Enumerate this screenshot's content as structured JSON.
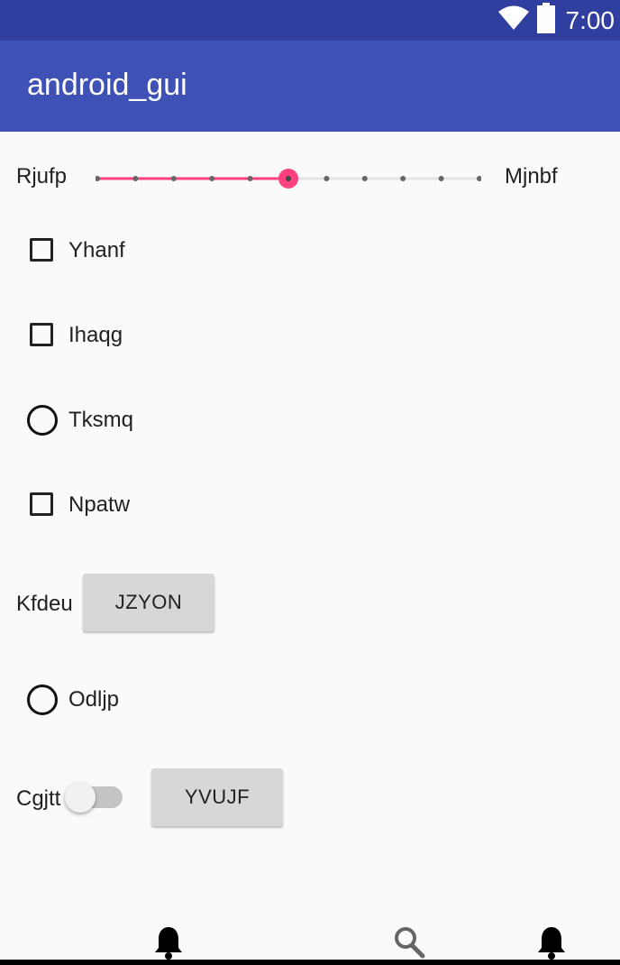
{
  "status_bar": {
    "time": "7:00",
    "icons": [
      "wifi-icon",
      "battery-icon"
    ]
  },
  "app_bar": {
    "title": "android_gui"
  },
  "slider": {
    "left_label": "Rjufp",
    "right_label": "Mjnbf",
    "steps": 10,
    "value": 5,
    "accent_color": "#ff4081"
  },
  "options": [
    {
      "type": "checkbox",
      "label": "Yhanf",
      "checked": false
    },
    {
      "type": "checkbox",
      "label": "Ihaqg",
      "checked": false
    },
    {
      "type": "radio",
      "label": "Tksmq",
      "checked": false
    },
    {
      "type": "checkbox",
      "label": "Npatw",
      "checked": false
    }
  ],
  "button_row": {
    "label": "Kfdeu",
    "button": "JZYON"
  },
  "radio_odljp": {
    "label": "Odljp",
    "checked": false
  },
  "switch_row": {
    "label": "Cgjtt",
    "on": false,
    "button": "YVUJF"
  },
  "bottom_nav": {
    "icons": [
      "bell-icon",
      "search-icon",
      "bell-icon"
    ]
  },
  "colors": {
    "primary": "#3f51b5",
    "primary_dark": "#303f9f",
    "accent": "#ff4081",
    "background": "#fafafa"
  }
}
